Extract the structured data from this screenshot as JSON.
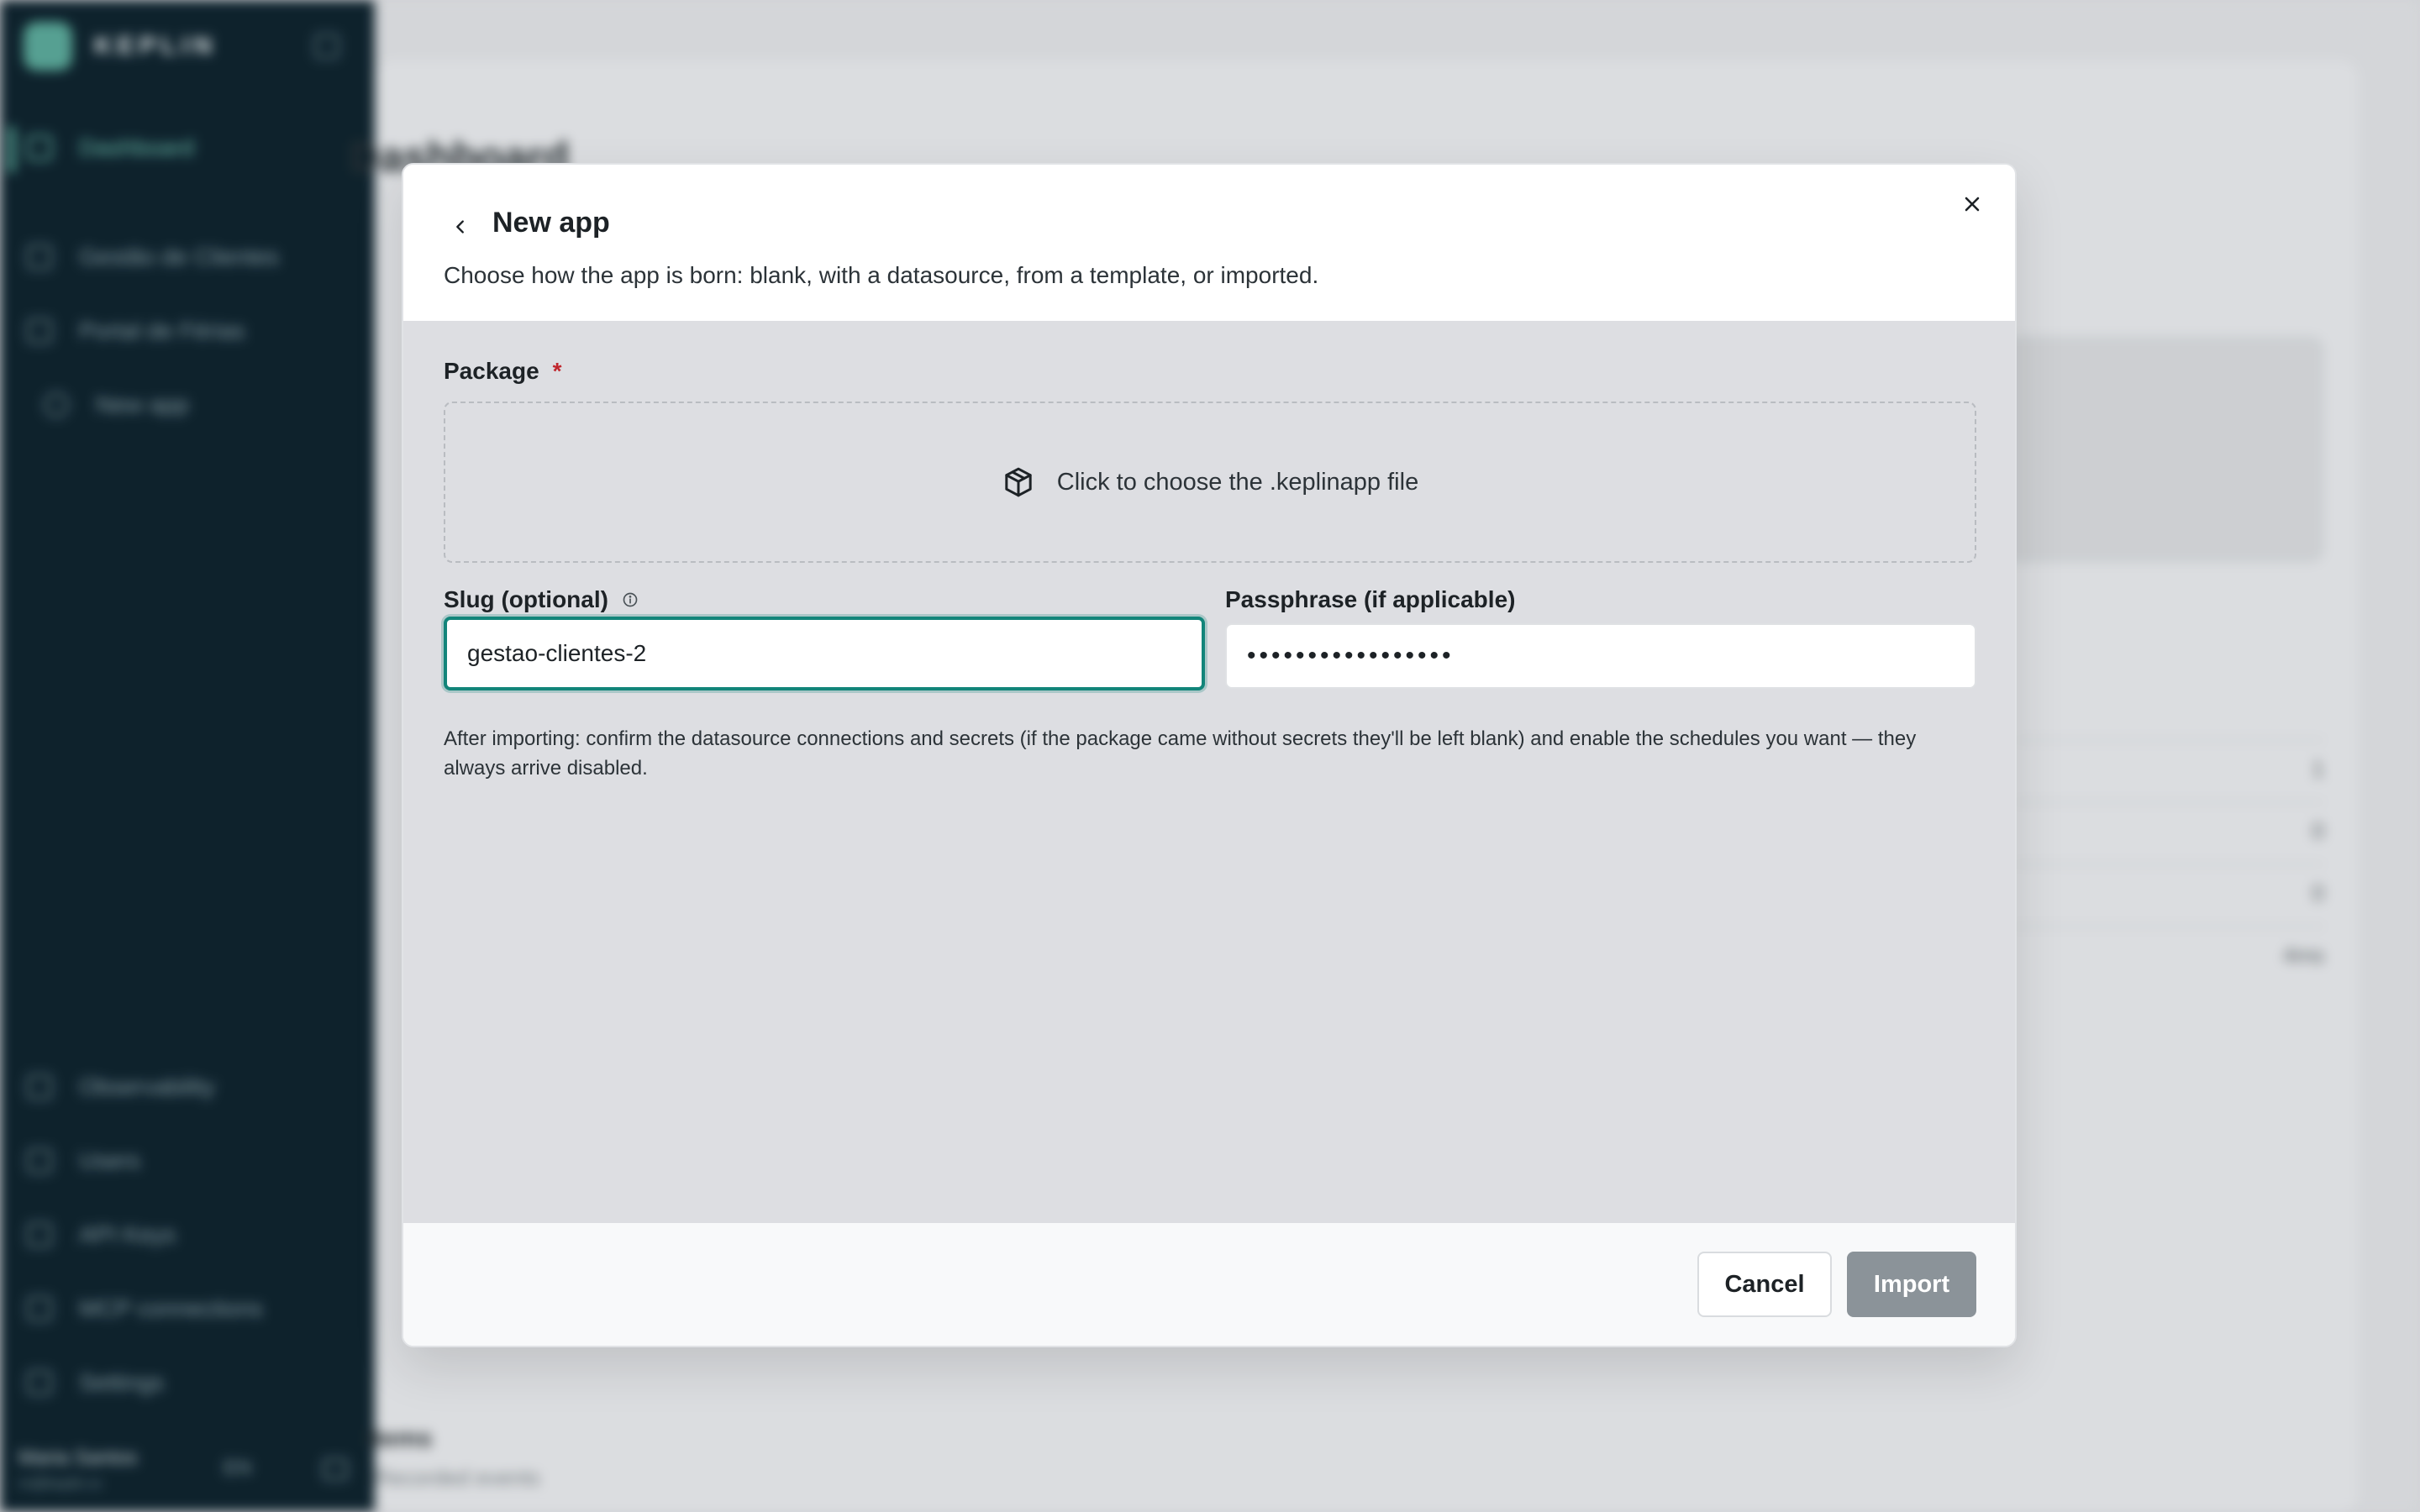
{
  "sidebar": {
    "brand": "KEPLIN",
    "items": [
      {
        "label": "Dashboard"
      },
      {
        "label": "Gestão de Clientes"
      },
      {
        "label": "Portal de Férias"
      },
      {
        "label": "New app"
      }
    ],
    "bottom_items": [
      {
        "label": "Observability"
      },
      {
        "label": "Users"
      },
      {
        "label": "API Keys"
      },
      {
        "label": "MCP connections"
      },
      {
        "label": "Settings"
      }
    ],
    "user": {
      "name": "Maria Santos",
      "email": "m@keplin.io"
    },
    "language": "EN"
  },
  "background": {
    "page_title": "Dashboard",
    "rows": [
      "1",
      "0",
      "0",
      "4ms"
    ],
    "section_title": "Items",
    "section_sub": "Recorded events"
  },
  "modal": {
    "title": "New app",
    "description": "Choose how the app is born: blank, with a datasource, from a template, or imported.",
    "package": {
      "label": "Package",
      "required_mark": "*",
      "dropzone_text": "Click to choose the .keplinapp file"
    },
    "slug": {
      "label": "Slug (optional)",
      "value": "gestao-clientes-2"
    },
    "passphrase": {
      "label": "Passphrase (if applicable)",
      "value": "•••••••••••••••••"
    },
    "help_text": "After importing: confirm the datasource connections and secrets (if the package came without secrets they'll be left blank) and enable the schedules you want — they always arrive disabled.",
    "cancel_label": "Cancel",
    "import_label": "Import"
  },
  "colors": {
    "focus_ring": "#12857a",
    "required": "#c0262d",
    "sidebar_bg": "#0e222d",
    "import_disabled": "#8b9399"
  }
}
